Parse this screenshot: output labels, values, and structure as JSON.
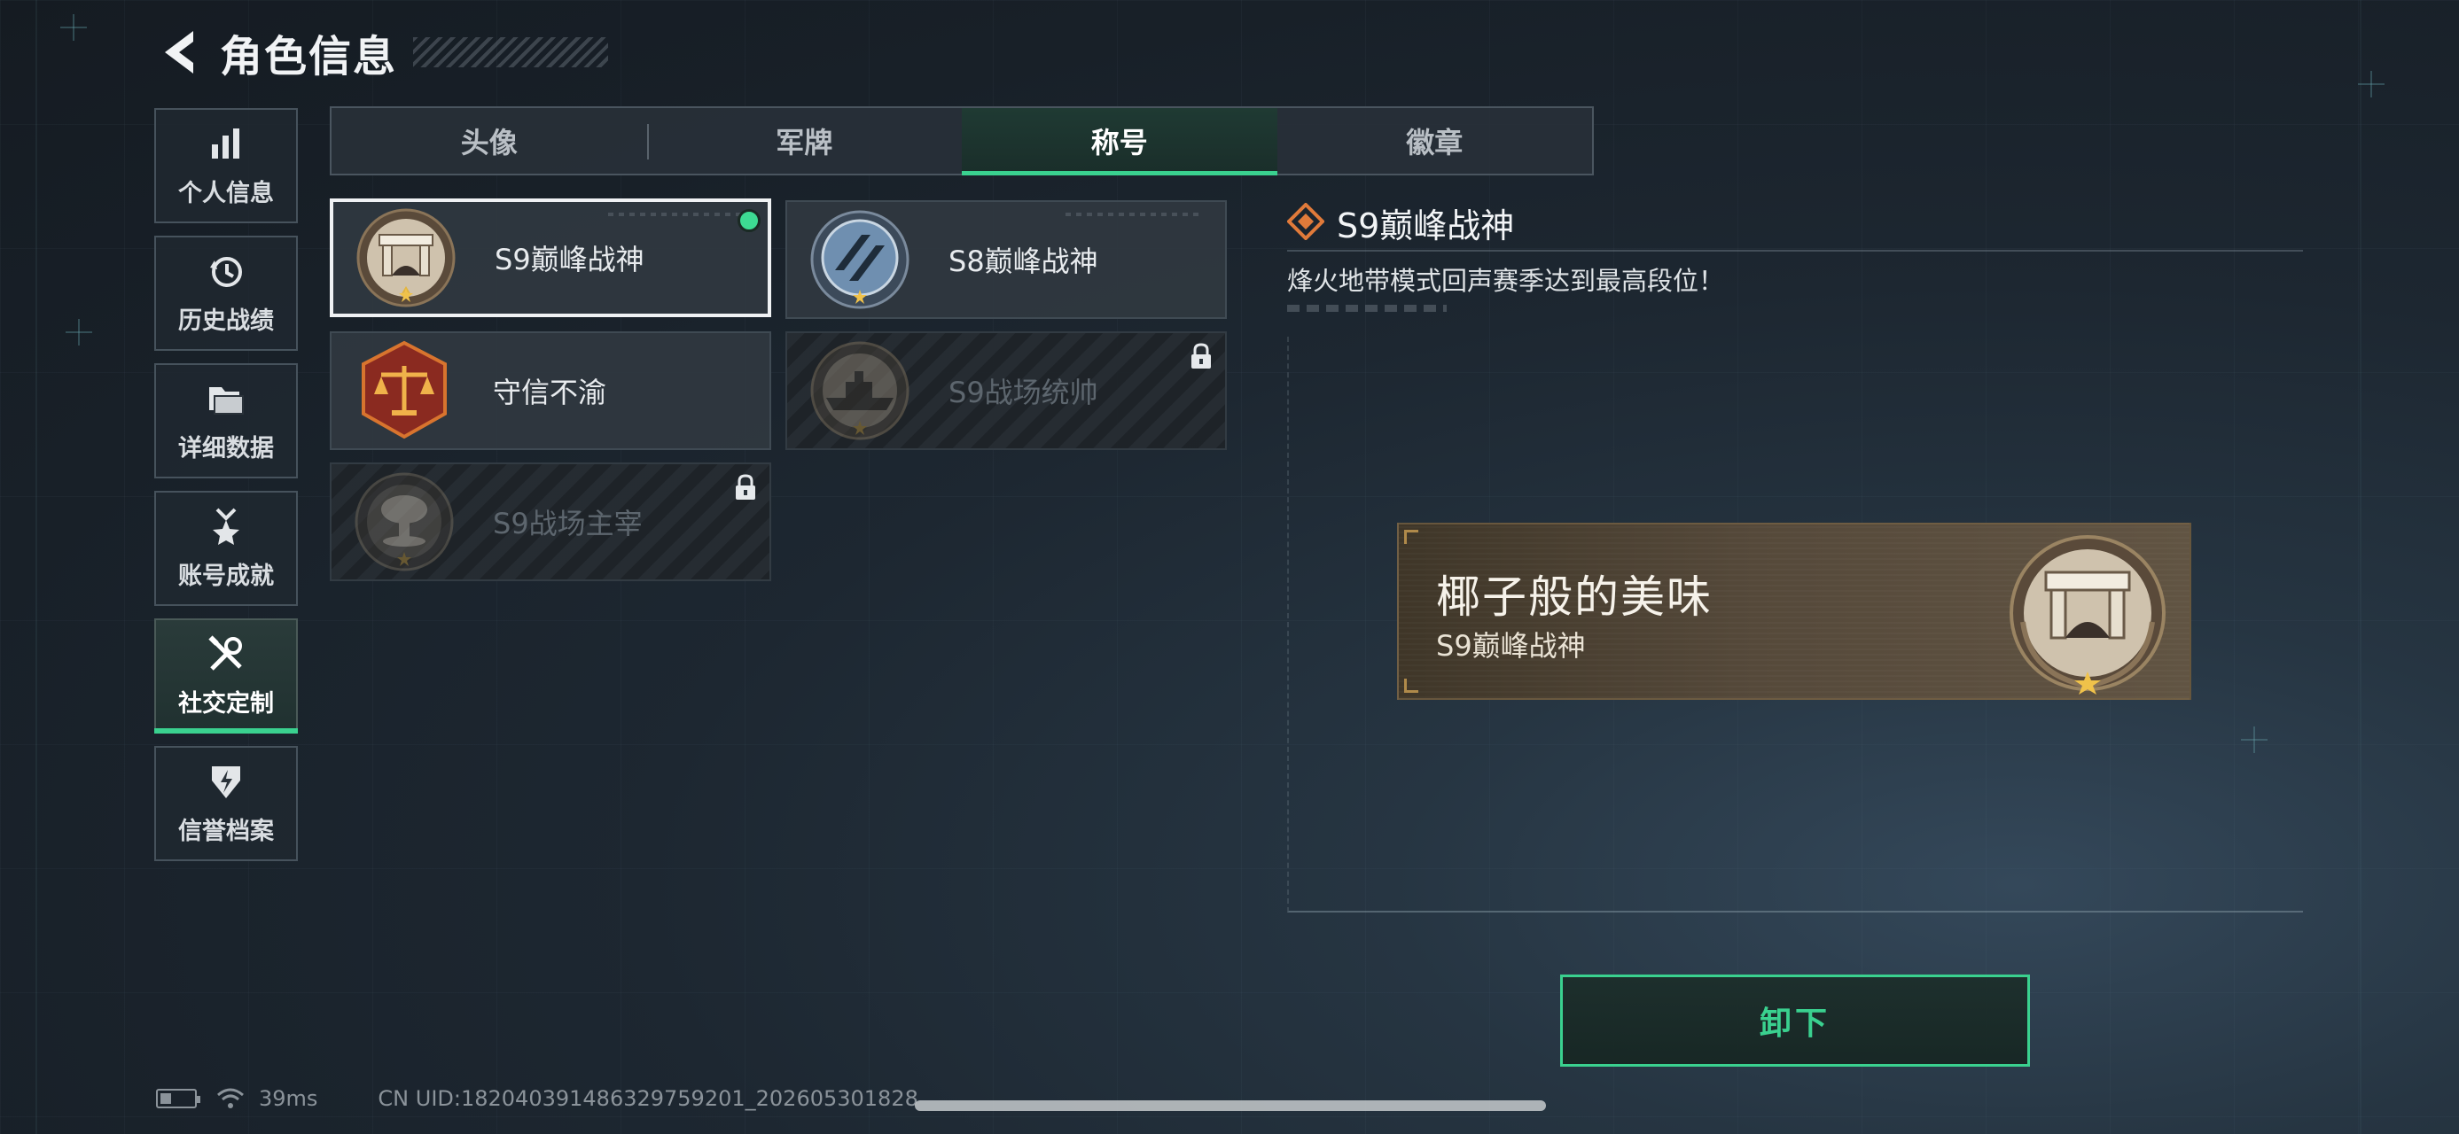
{
  "header": {
    "title": "角色信息"
  },
  "sidebar": {
    "items": [
      {
        "label": "个人信息",
        "icon": "bar-chart-icon"
      },
      {
        "label": "历史战绩",
        "icon": "history-clock-icon"
      },
      {
        "label": "详细数据",
        "icon": "folder-icon"
      },
      {
        "label": "账号成就",
        "icon": "medal-icon"
      },
      {
        "label": "社交定制",
        "icon": "tools-icon",
        "active": true
      },
      {
        "label": "信誉档案",
        "icon": "shield-emblem-icon"
      }
    ]
  },
  "tabs": [
    {
      "label": "头像"
    },
    {
      "label": "军牌"
    },
    {
      "label": "称号",
      "active": true
    },
    {
      "label": "徽章"
    }
  ],
  "titles": [
    {
      "name": "S9巅峰战神",
      "badge": "fortress-badge-icon",
      "selected": true,
      "equipped": true,
      "locked": false
    },
    {
      "name": "S8巅峰战神",
      "badge": "blue-emblem-badge-icon",
      "selected": false,
      "equipped": false,
      "locked": false
    },
    {
      "name": "守信不渝",
      "badge": "scales-badge-icon",
      "selected": false,
      "equipped": false,
      "locked": false
    },
    {
      "name": "S9战场统帅",
      "badge": "warship-badge-icon",
      "selected": false,
      "equipped": false,
      "locked": true
    },
    {
      "name": "S9战场主宰",
      "badge": "mushroom-cloud-badge-icon",
      "selected": false,
      "equipped": false,
      "locked": true
    }
  ],
  "detail": {
    "title": "S9巅峰战神",
    "description": "烽火地带模式回声赛季达到最高段位！",
    "icon": "diamond-rank-icon"
  },
  "preview": {
    "nickname": "椰子般的美味",
    "title": "S9巅峰战神",
    "badge": "fortress-badge-icon"
  },
  "actions": {
    "unequip_label": "卸下"
  },
  "status": {
    "ping": "39ms",
    "uid": "CN UID:1820403914863297592​01_202605301828"
  },
  "colors": {
    "accent": "#3ad18f",
    "background": "#1b232b",
    "panel": "#303840",
    "rank_orange": "#e07a3a"
  }
}
